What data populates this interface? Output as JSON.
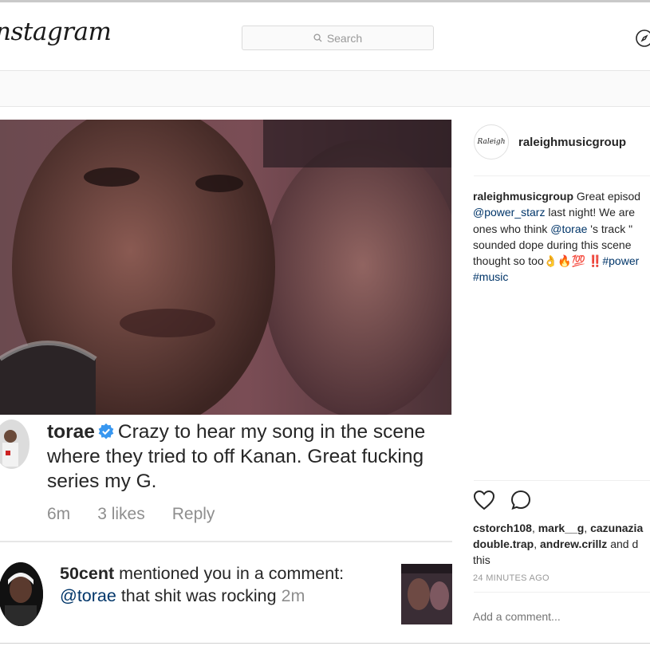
{
  "header": {
    "logo": "nstagram",
    "search_placeholder": "Search"
  },
  "post": {
    "author": "raleighmusicgroup",
    "avatar_text": "Raleigh",
    "caption_lines": [
      {
        "user": "raleighmusicgroup",
        "text": " Great episod"
      },
      {
        "link": "@power_starz",
        "text": " last night! We are"
      },
      {
        "text": "ones who think ",
        "link": "@torae",
        "text2": " 's track \""
      },
      {
        "text": "sounded dope during this scene"
      },
      {
        "text": "thought so too👌🔥💯 ‼️",
        "link": "#power"
      },
      {
        "link": "#music"
      }
    ],
    "likes_line1": {
      "u1": "cstorch108",
      "u2": "mark__g",
      "u3": "cazunazia"
    },
    "likes_line2": {
      "u1": "double.trap",
      "u2": "andrew.crillz",
      "tail": " and d"
    },
    "likes_line3": "this",
    "time": "24 MINUTES AGO",
    "add_comment_placeholder": "Add a comment..."
  },
  "notification_1": {
    "username": "torae",
    "text": "Crazy to hear my song in the scene where they tried to off Kanan. Great fucking series my G.",
    "age": "6m",
    "likes": "3 likes",
    "reply": "Reply"
  },
  "notification_2": {
    "username": "50cent",
    "text": " mentioned you in a comment: ",
    "mention": "@torae",
    "text2": " that shit was rocking ",
    "age": "2m"
  },
  "colors": {
    "link": "#003569",
    "muted": "#8e8e8e",
    "verified": "#3897f0"
  },
  "icons": [
    "search-icon",
    "compass-icon",
    "heart-icon",
    "comment-icon",
    "verified-icon"
  ]
}
